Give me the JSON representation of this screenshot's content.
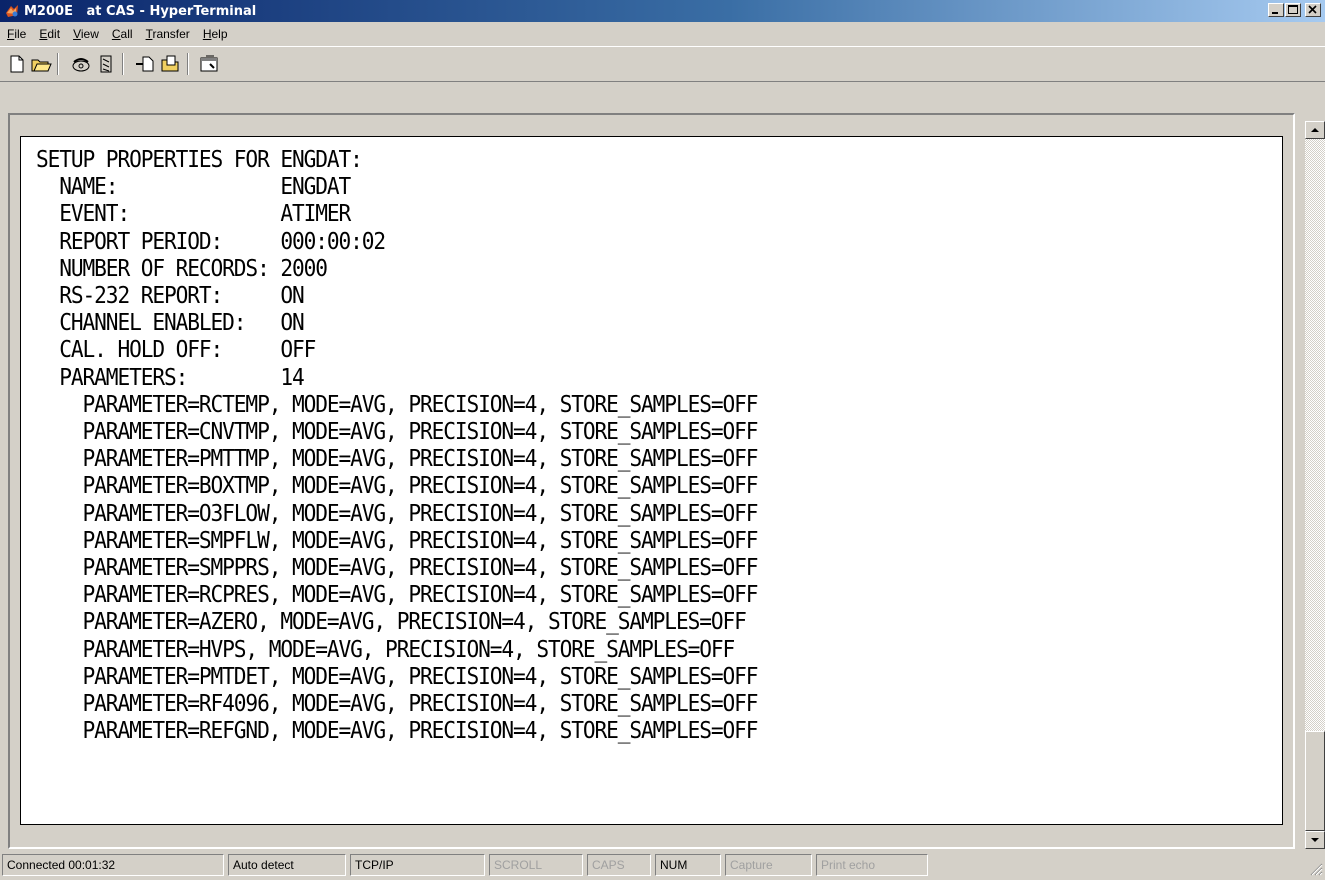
{
  "window": {
    "title": "M200E   at CAS - HyperTerminal"
  },
  "menu": {
    "items": [
      {
        "ul": "F",
        "rest": "ile"
      },
      {
        "ul": "E",
        "rest": "dit"
      },
      {
        "ul": "V",
        "rest": "iew"
      },
      {
        "ul": "C",
        "rest": "all"
      },
      {
        "ul": "T",
        "rest": "ransfer"
      },
      {
        "ul": "H",
        "rest": "elp"
      }
    ]
  },
  "toolbar": {
    "icons": [
      "new-document-icon",
      "open-folder-icon",
      "connect-phone-icon",
      "disconnect-phone-icon",
      "send-file-icon",
      "receive-file-icon",
      "properties-icon"
    ]
  },
  "terminal": {
    "lines": [
      "SETUP PROPERTIES FOR ENGDAT:",
      "  NAME:              ENGDAT",
      "  EVENT:             ATIMER",
      "  REPORT PERIOD:     000:00:02",
      "  NUMBER OF RECORDS: 2000",
      "  RS-232 REPORT:     ON",
      "  CHANNEL ENABLED:   ON",
      "  CAL. HOLD OFF:     OFF",
      "  PARAMETERS:        14",
      "    PARAMETER=RCTEMP, MODE=AVG, PRECISION=4, STORE_SAMPLES=OFF",
      "    PARAMETER=CNVTMP, MODE=AVG, PRECISION=4, STORE_SAMPLES=OFF",
      "    PARAMETER=PMTTMP, MODE=AVG, PRECISION=4, STORE_SAMPLES=OFF",
      "    PARAMETER=BOXTMP, MODE=AVG, PRECISION=4, STORE_SAMPLES=OFF",
      "    PARAMETER=O3FLOW, MODE=AVG, PRECISION=4, STORE_SAMPLES=OFF",
      "    PARAMETER=SMPFLW, MODE=AVG, PRECISION=4, STORE_SAMPLES=OFF",
      "    PARAMETER=SMPPRS, MODE=AVG, PRECISION=4, STORE_SAMPLES=OFF",
      "    PARAMETER=RCPRES, MODE=AVG, PRECISION=4, STORE_SAMPLES=OFF",
      "    PARAMETER=AZERO, MODE=AVG, PRECISION=4, STORE_SAMPLES=OFF",
      "    PARAMETER=HVPS, MODE=AVG, PRECISION=4, STORE_SAMPLES=OFF",
      "    PARAMETER=PMTDET, MODE=AVG, PRECISION=4, STORE_SAMPLES=OFF",
      "    PARAMETER=RF4096, MODE=AVG, PRECISION=4, STORE_SAMPLES=OFF",
      "    PARAMETER=REFGND, MODE=AVG, PRECISION=4, STORE_SAMPLES=OFF"
    ]
  },
  "statusbar": {
    "connected": "Connected 00:01:32",
    "detect": "Auto detect",
    "protocol": "TCP/IP",
    "scroll": "SCROLL",
    "caps": "CAPS",
    "num": "NUM",
    "capture": "Capture",
    "print_echo": "Print echo"
  }
}
